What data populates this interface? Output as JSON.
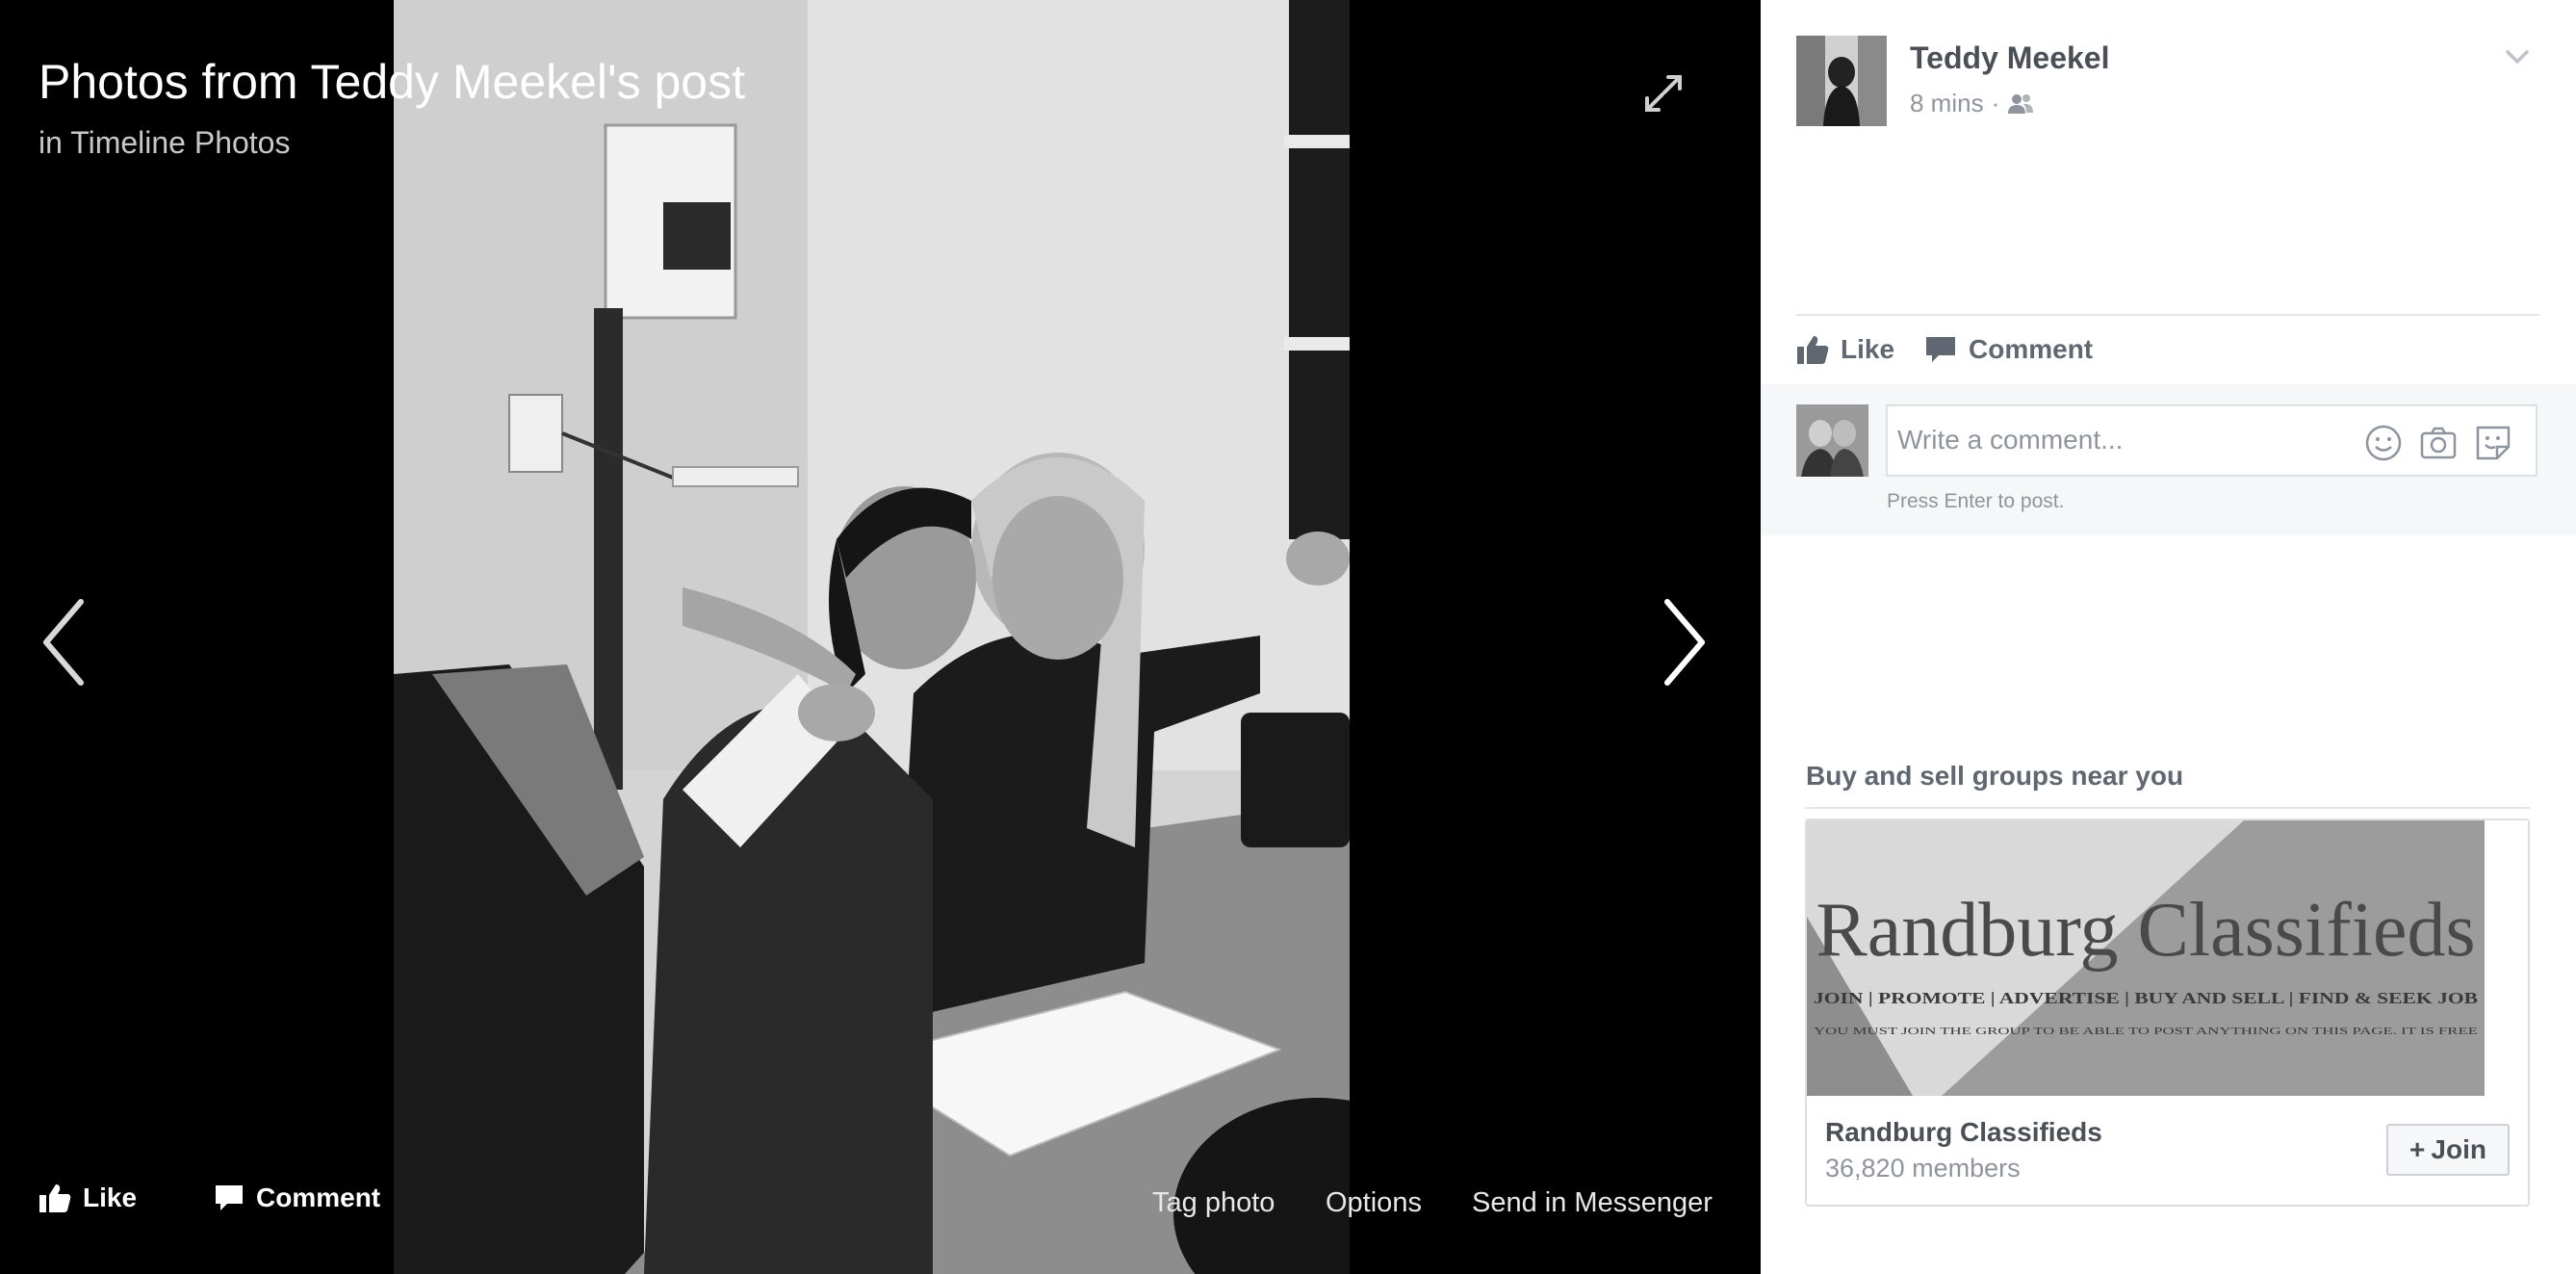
{
  "viewer": {
    "title": "Photos from Teddy Meekel's post",
    "subtitle": "in Timeline Photos",
    "like_label": "Like",
    "comment_label": "Comment",
    "tag_photo_label": "Tag photo",
    "options_label": "Options",
    "send_label": "Send in Messenger",
    "icons": [
      "expand-icon",
      "chevron-left-icon",
      "chevron-right-icon",
      "thumbs-up-icon",
      "comment-icon"
    ]
  },
  "post": {
    "author": "Teddy Meekel",
    "time": "8 mins",
    "separator": "·",
    "audience_icon": "friends-icon",
    "like_label": "Like",
    "comment_label": "Comment"
  },
  "comment": {
    "placeholder": "Write a comment...",
    "hint": "Press Enter to post.",
    "icons": [
      "emoji-icon",
      "camera-icon",
      "sticker-icon"
    ]
  },
  "groups": {
    "heading": "Buy and sell groups near you",
    "items": [
      {
        "banner_title": "Randburg Classifieds",
        "banner_tagline": "JOIN | PROMOTE | ADVERTISE | BUY AND SELL | FIND & SEEK JOB",
        "banner_notice": "YOU MUST JOIN THE GROUP TO BE ABLE TO POST ANYTHING ON THIS PAGE. IT IS FREE",
        "name": "Randburg Classifieds",
        "members": "36,820 members",
        "join_label": "Join",
        "join_prefix": "+"
      }
    ]
  },
  "colors": {
    "panel_bg": "#ffffff",
    "viewer_bg": "#000000",
    "text_dark": "#4b4f56",
    "text_muted": "#90949c"
  }
}
